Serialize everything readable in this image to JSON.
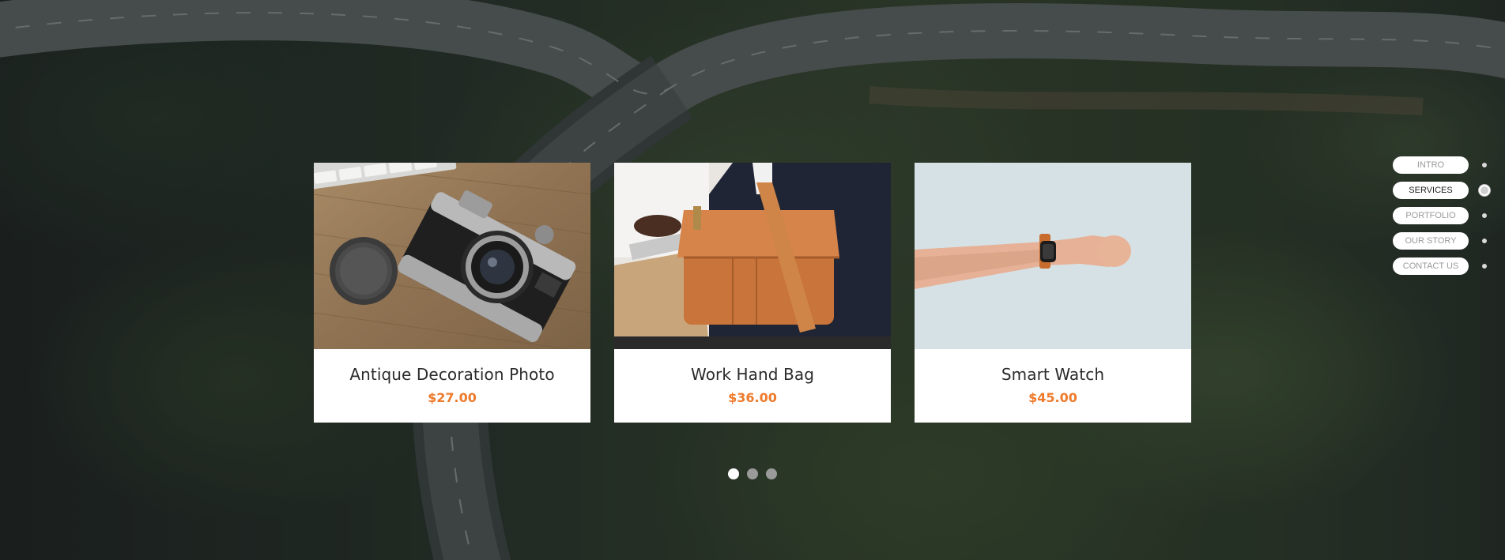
{
  "products": [
    {
      "name": "Antique Decoration Photo",
      "price": "$27.00",
      "image": "camera-photo"
    },
    {
      "name": "Work Hand Bag",
      "price": "$36.00",
      "image": "leather-bag-photo"
    },
    {
      "name": "Smart Watch",
      "price": "$45.00",
      "image": "smart-watch-photo"
    }
  ],
  "slider": {
    "pages": 3,
    "active_index": 0
  },
  "section_nav": {
    "items": [
      {
        "label": "INTRO",
        "active": false
      },
      {
        "label": "SERVICES",
        "active": true
      },
      {
        "label": "PORTFOLIO",
        "active": false
      },
      {
        "label": "OUR STORY",
        "active": false
      },
      {
        "label": "CONTACT US",
        "active": false
      }
    ]
  },
  "colors": {
    "price_accent": "#ee7a2b",
    "card_background": "#ffffff",
    "dot_active": "#ffffff",
    "dot_inactive": "#9a9a9a"
  }
}
